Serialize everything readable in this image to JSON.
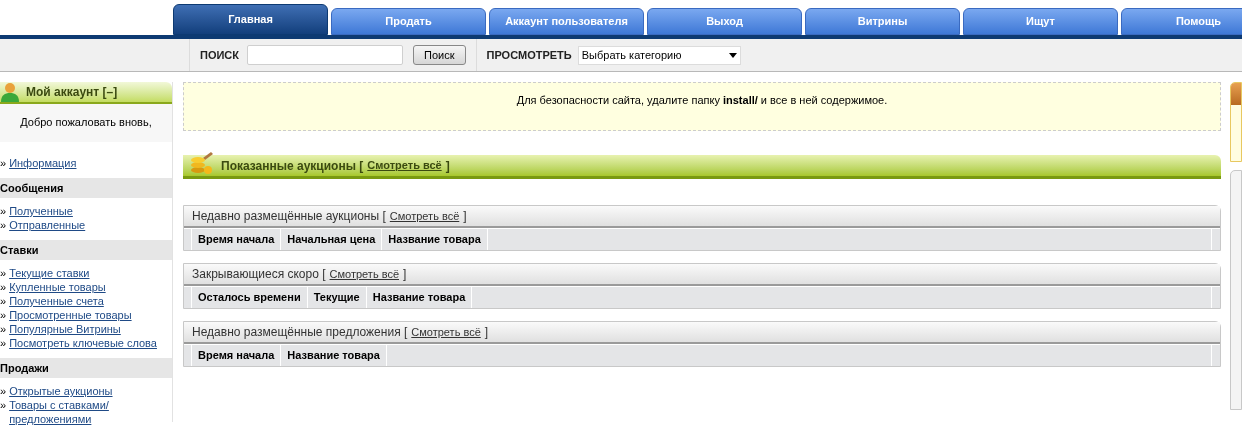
{
  "tabs": [
    {
      "label": "Главная",
      "selected": true
    },
    {
      "label": "Продать",
      "selected": false
    },
    {
      "label": "Аккаунт пользователя",
      "selected": false
    },
    {
      "label": "Выход",
      "selected": false
    },
    {
      "label": "Витрины",
      "selected": false
    },
    {
      "label": "Ищут",
      "selected": false
    },
    {
      "label": "Помощь",
      "selected": false
    }
  ],
  "search_bar": {
    "search_label": "ПОИСК",
    "search_button": "Поиск",
    "browse_label": "ПРОСМОТРЕТЬ",
    "category_select": "Выбрать категорию"
  },
  "sidebar": {
    "title": "Мой аккаунт",
    "toggle": "[–]",
    "welcome": "Добро пожаловать вновь,",
    "sections": [
      {
        "links": [
          {
            "bullet": "»",
            "label": "Информация"
          }
        ]
      },
      {
        "heading": "Сообщения",
        "links": [
          {
            "bullet": "»",
            "label": "Полученные"
          },
          {
            "bullet": "»",
            "label": "Отправленные"
          }
        ]
      },
      {
        "heading": "Ставки",
        "links": [
          {
            "bullet": "»",
            "label": "Текущие ставки"
          },
          {
            "bullet": "»",
            "label": "Купленные товары"
          },
          {
            "bullet": "»",
            "label": "Полученные счета"
          },
          {
            "bullet": "»",
            "label": "Просмотренные товары"
          },
          {
            "bullet": "»",
            "label": "Популярные Витрины"
          },
          {
            "bullet": "»",
            "label": "Посмотреть ключевые слова"
          }
        ]
      },
      {
        "heading": "Продажи",
        "links": [
          {
            "bullet": "»",
            "label": "Открытые аукционы"
          },
          {
            "bullet": "»",
            "label": "Товары с ставками/предложениями"
          }
        ]
      }
    ]
  },
  "notice": "Для безопасности сайта, удалите папку **install/** и все в ней содержимое.",
  "featured": {
    "title": "Показанные аукционы [",
    "link": "Смотреть всё",
    "close": "]"
  },
  "tables": [
    {
      "title": "Недавно размещённые аукционы [",
      "link": "Смотреть всё",
      "close": "]",
      "columns": [
        "Время начала",
        "Начальная цена",
        "Название товара"
      ]
    },
    {
      "title": "Закрывающиеся скоро [",
      "link": "Смотреть всё",
      "close": "]",
      "columns": [
        "Осталось времени",
        "Текущие",
        "Название товара"
      ]
    },
    {
      "title": "Недавно размещённые предложения [",
      "link": "Смотреть всё",
      "close": "]",
      "columns": [
        "Время начала",
        "Название товара"
      ]
    }
  ]
}
